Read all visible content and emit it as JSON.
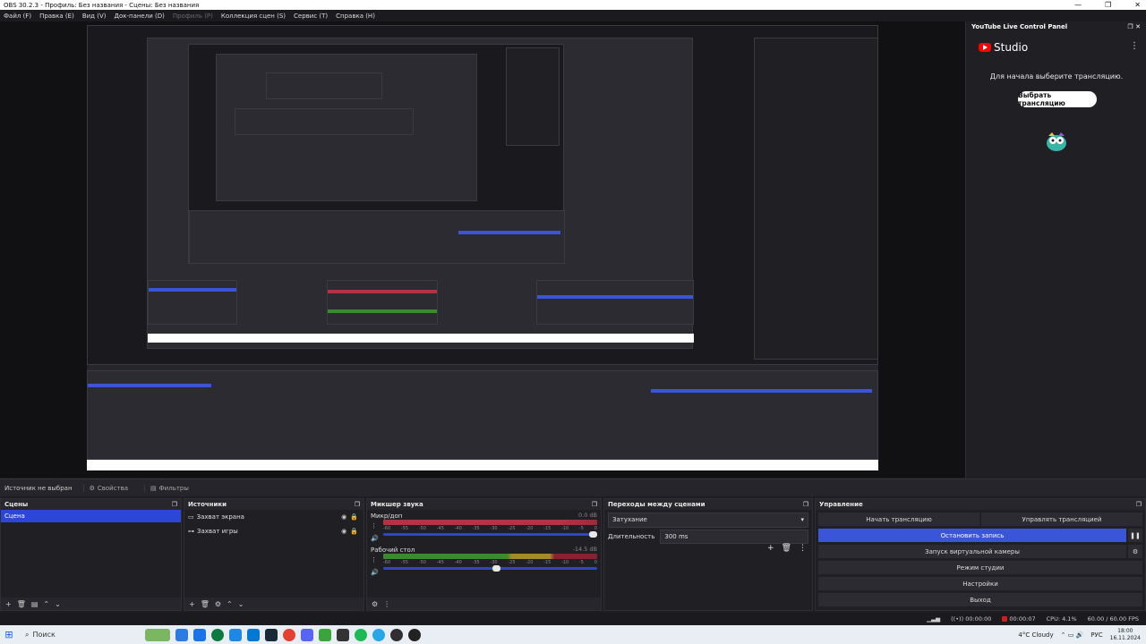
{
  "window": {
    "title": "OBS 30.2.3 - Профиль: Без названия - Сцены: Без названия",
    "controls": [
      "—",
      "❐",
      "✕"
    ]
  },
  "menu": {
    "file": "Файл (F)",
    "edit": "Правка (E)",
    "view": "Вид (V)",
    "docks": "Док-панели (D)",
    "profile": "Профиль (P)",
    "scene_collection": "Коллекция сцен (S)",
    "tools": "Сервис (T)",
    "help": "Справка (H)"
  },
  "youtube_panel": {
    "title": "YouTube Live Control Panel",
    "logo_text": "Studio",
    "prompt": "Для начала выберите трансляцию.",
    "button": "Выбрать трансляцию"
  },
  "source_bar": {
    "status": "Источник не выбран",
    "properties": "Свойства",
    "filters": "Фильтры"
  },
  "scenes": {
    "title": "Сцены",
    "items": [
      "Сцена"
    ]
  },
  "sources": {
    "title": "Источники",
    "items": [
      "Захват экрана",
      "Захват игры"
    ]
  },
  "mixer": {
    "title": "Микшер звука",
    "channels": [
      {
        "name": "Микр/доп",
        "db": "0.0 dB",
        "ticks": [
          "-60",
          "-55",
          "-50",
          "-45",
          "-40",
          "-35",
          "-30",
          "-25",
          "-20",
          "-15",
          "-10",
          "-5",
          "0"
        ],
        "volume": 1.0
      },
      {
        "name": "Рабочий стол",
        "db": "-14.5 dB",
        "ticks": [
          "-60",
          "-55",
          "-50",
          "-45",
          "-40",
          "-35",
          "-30",
          "-25",
          "-20",
          "-15",
          "-10",
          "-5",
          "0"
        ],
        "volume": 0.55
      }
    ]
  },
  "transitions": {
    "title": "Переходы между сценами",
    "selected": "Затухание",
    "duration_label": "Длительность",
    "duration_value": "300 ms"
  },
  "controls": {
    "title": "Управление",
    "start_stream": "Начать трансляцию",
    "manage_stream": "Управлять трансляцией",
    "stop_recording": "Остановить запись",
    "virtual_camera": "Запуск виртуальной камеры",
    "studio_mode": "Режим студии",
    "settings": "Настройки",
    "exit": "Выход"
  },
  "status": {
    "stream_time": "00:00:00",
    "rec_time": "00:00:07",
    "cpu": "CPU: 4.1%",
    "fps": "60.00 / 60.00 FPS"
  },
  "taskbar": {
    "search": "Поиск",
    "weather": "4°C Cloudy",
    "lang": "РУС",
    "time": "18:00",
    "date": "16.11.2024"
  },
  "colors": {
    "accent": "#3b55d9",
    "record": "#d01e1e",
    "youtube_red": "#ff0000"
  }
}
